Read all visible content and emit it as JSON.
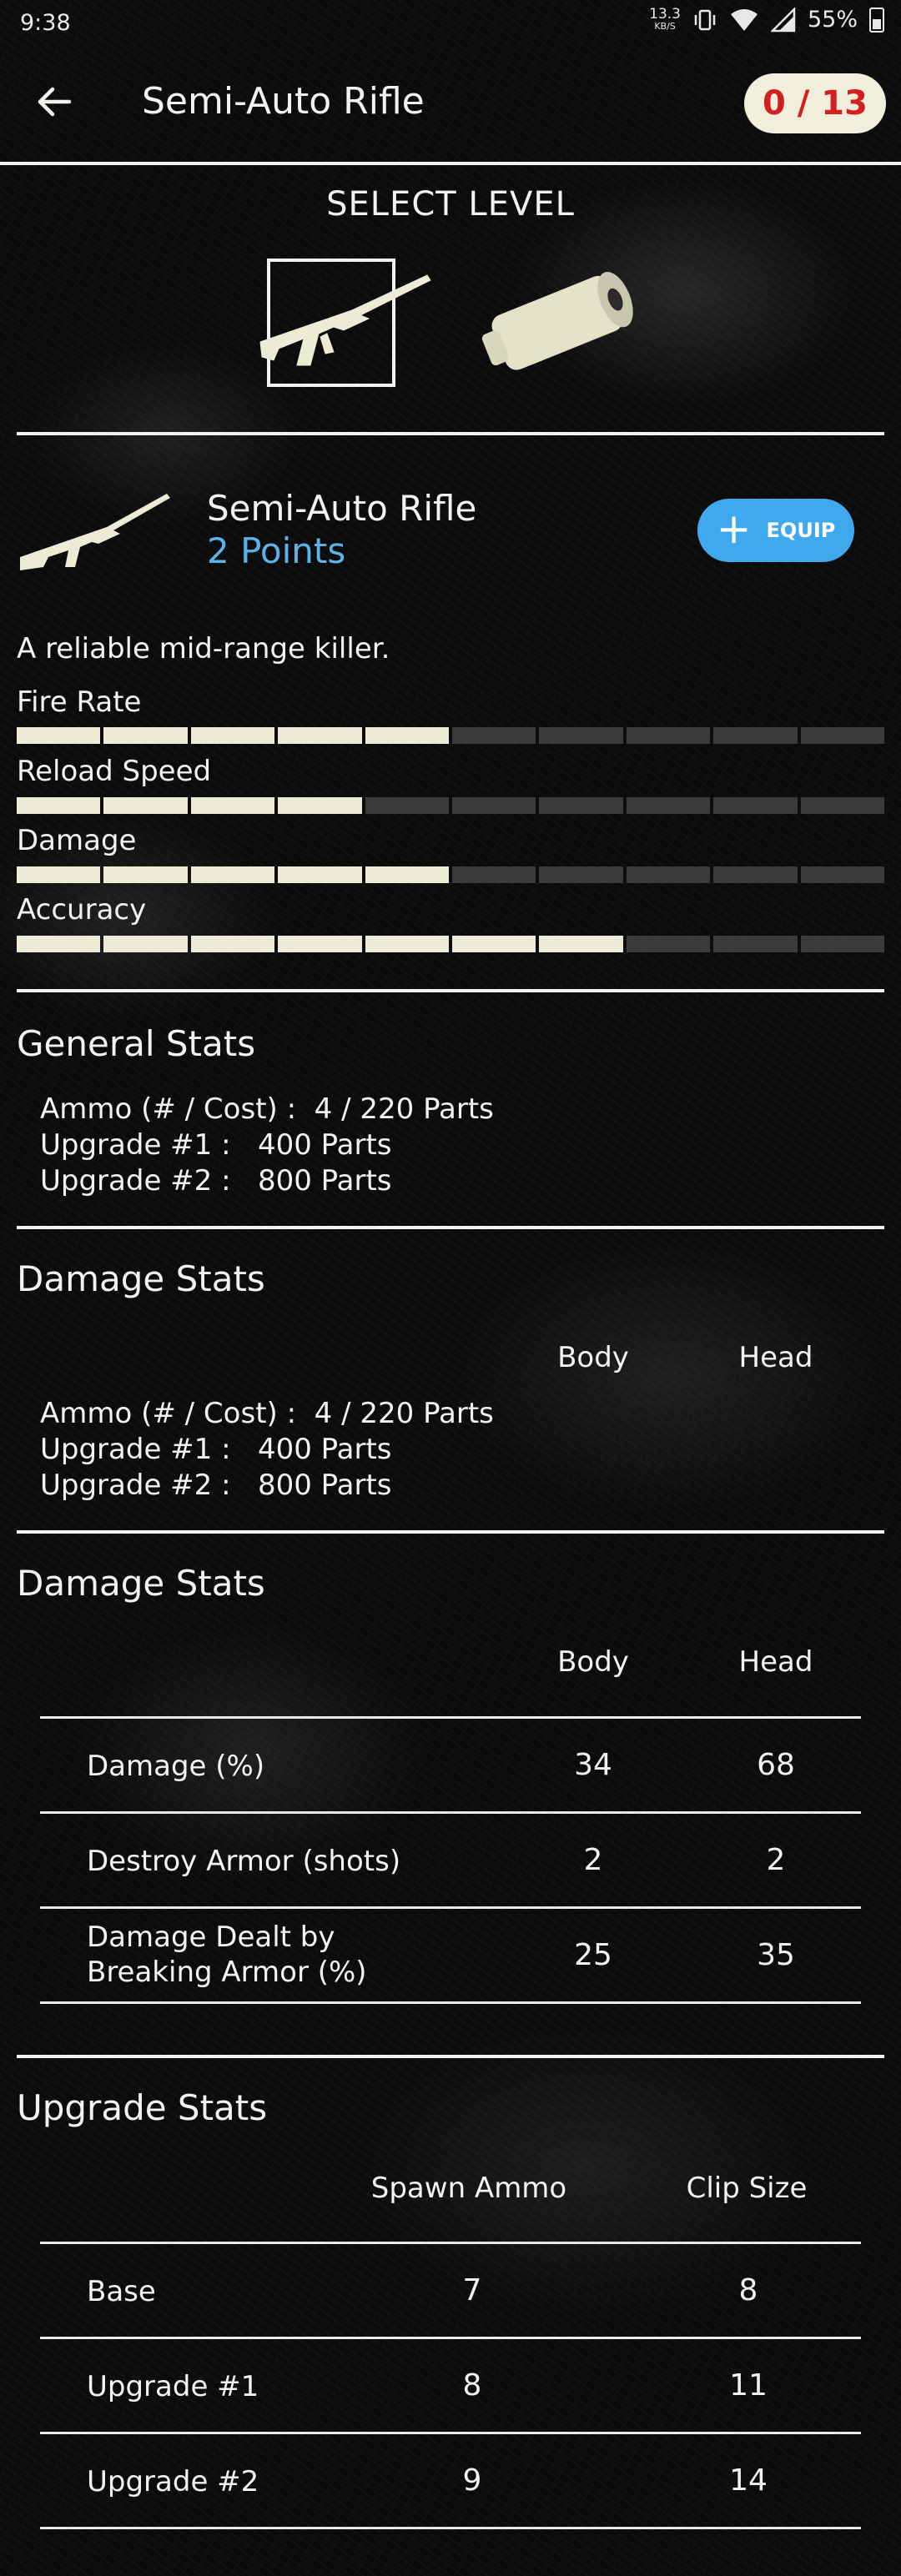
{
  "status_bar": {
    "time": "9:38",
    "net_speed": "13.3",
    "net_unit": "KB/S",
    "battery": "55%"
  },
  "header": {
    "title": "Semi-Auto Rifle",
    "points_badge": "0 / 13",
    "badge_color": "#d21f1f"
  },
  "select_level": {
    "title": "SELECT LEVEL",
    "items": [
      "rifle-icon",
      "silencer-icon"
    ]
  },
  "weapon": {
    "name": "Semi-Auto Rifle",
    "points": "2 Points",
    "equip_label": "EQUIP",
    "description": "A reliable mid-range killer.",
    "accent_color": "#40a9ee"
  },
  "stats": [
    {
      "label": "Fire Rate",
      "filled": 5,
      "total": 10
    },
    {
      "label": "Reload Speed",
      "filled": 4,
      "total": 10
    },
    {
      "label": "Damage",
      "filled": 5,
      "total": 10
    },
    {
      "label": "Accuracy",
      "filled": 7,
      "total": 10
    }
  ],
  "general_stats": {
    "title": "General Stats",
    "lines": [
      "Ammo (# / Cost) :  4 / 220 Parts",
      "Upgrade #1 :   400 Parts",
      "Upgrade #2 :   800 Parts"
    ]
  },
  "damage_stats_1": {
    "title": "Damage Stats",
    "col_body": "Body",
    "col_head": "Head",
    "lines": [
      "Ammo (# / Cost) :  4 / 220 Parts",
      "Upgrade #1 :   400 Parts",
      "Upgrade #2 :   800 Parts"
    ]
  },
  "damage_stats_2": {
    "title": "Damage Stats",
    "col_body": "Body",
    "col_head": "Head",
    "rows": [
      {
        "label": "Damage (%)",
        "body": "34",
        "head": "68"
      },
      {
        "label": "Destroy Armor (shots)",
        "body": "2",
        "head": "2"
      },
      {
        "label": "Damage Dealt by\nBreaking Armor (%)",
        "body": "25",
        "head": "35"
      }
    ]
  },
  "upgrade_stats": {
    "title": "Upgrade Stats",
    "col_spawn": "Spawn Ammo",
    "col_clip": "Clip Size",
    "rows": [
      {
        "label": "Base",
        "spawn": "7",
        "clip": "8"
      },
      {
        "label": "Upgrade #1",
        "spawn": "8",
        "clip": "11"
      },
      {
        "label": "Upgrade #2",
        "spawn": "9",
        "clip": "14"
      }
    ]
  }
}
